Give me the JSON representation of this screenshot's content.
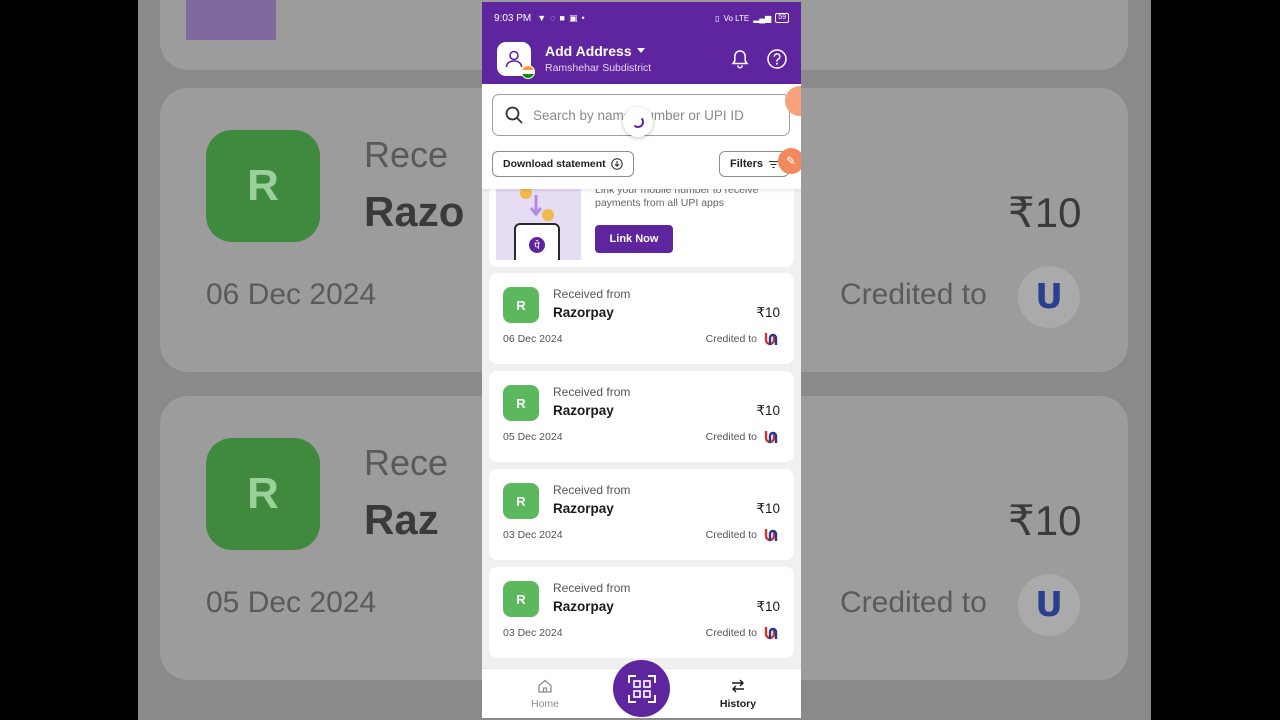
{
  "status_bar": {
    "time": "9:03 PM",
    "network": "Vo LTE",
    "battery": "59"
  },
  "header": {
    "title": "Add Address",
    "subtitle": "Ramshehar Subdistrict",
    "icons": [
      "profile-icon",
      "bell-icon",
      "help-icon"
    ]
  },
  "search": {
    "placeholder": "Search by name, number or UPI ID"
  },
  "toolbar": {
    "download_label": "Download statement",
    "filters_label": "Filters"
  },
  "promo": {
    "text": "Link your mobile number to receive payments from all UPI apps",
    "button_label": "Link Now"
  },
  "transactions": [
    {
      "initial": "R",
      "label": "Received from",
      "name": "Razorpay",
      "amount": "₹10",
      "date": "06 Dec 2024",
      "credited": "Credited to"
    },
    {
      "initial": "R",
      "label": "Received from",
      "name": "Razorpay",
      "amount": "₹10",
      "date": "05 Dec 2024",
      "credited": "Credited to"
    },
    {
      "initial": "R",
      "label": "Received from",
      "name": "Razorpay",
      "amount": "₹10",
      "date": "03 Dec 2024",
      "credited": "Credited to"
    },
    {
      "initial": "R",
      "label": "Received from",
      "name": "Razorpay",
      "amount": "₹10",
      "date": "03 Dec 2024",
      "credited": "Credited to"
    }
  ],
  "bottom_nav": {
    "home_label": "Home",
    "history_label": "History"
  },
  "background": {
    "c1_label": "Rece",
    "c1_name": "Razo",
    "c1_amount": "₹10",
    "c1_date": "06 Dec 2024",
    "c1_credited": "Credited to",
    "c2_label": "Rece",
    "c2_name": "Raz",
    "c2_amount": "₹10",
    "c2_date": "05 Dec 2024",
    "c2_credited": "Credited to",
    "initial": "R"
  },
  "colors": {
    "brand": "#5f259f",
    "avatar_green": "#5cb85c",
    "accent_peach": "#f28a5e"
  }
}
